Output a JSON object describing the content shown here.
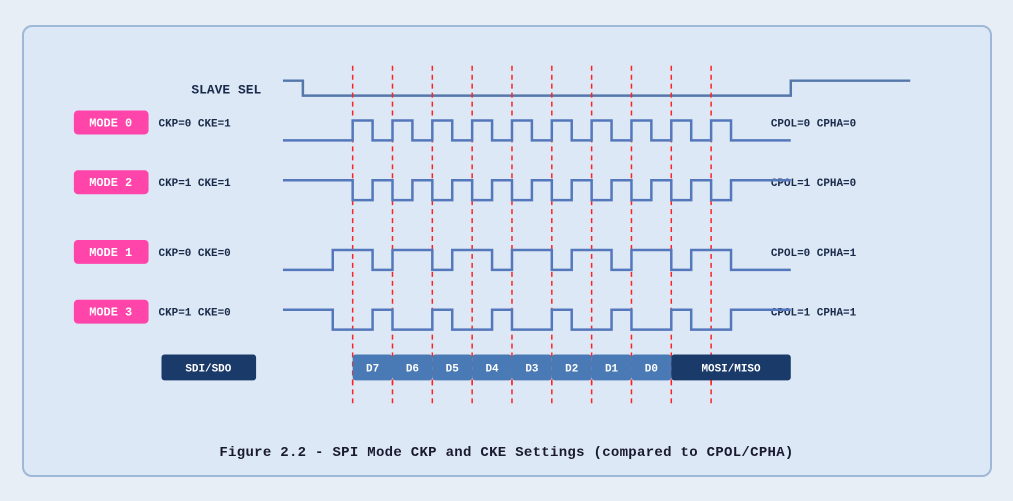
{
  "caption": "Figure 2.2 - SPI Mode CKP and CKE Settings (compared to CPOL/CPHA)",
  "diagram": {
    "slave_sel_label": "SLAVE SEL",
    "modes": [
      {
        "label": "MODE 0",
        "params": "CKP=0  CKE=1",
        "right": "CPOL=0  CPHA=0",
        "type": "high-idle"
      },
      {
        "label": "MODE 2",
        "params": "CKP=1  CKE=1",
        "right": "CPOL=1  CPHA=0",
        "type": "low-idle"
      },
      {
        "label": "MODE 1",
        "params": "CKP=0  CKE=0",
        "right": "CPOL=0  CPHA=1",
        "type": "high-idle-shifted"
      },
      {
        "label": "MODE 3",
        "params": "CKP=1  CKE=0",
        "right": "CPOL=1  CPHA=1",
        "type": "low-idle-shifted"
      }
    ],
    "data_labels": [
      "SDI/SDO",
      "D7",
      "D6",
      "D5",
      "D4",
      "D3",
      "D2",
      "D1",
      "D0",
      "MOSI/MISO"
    ]
  }
}
